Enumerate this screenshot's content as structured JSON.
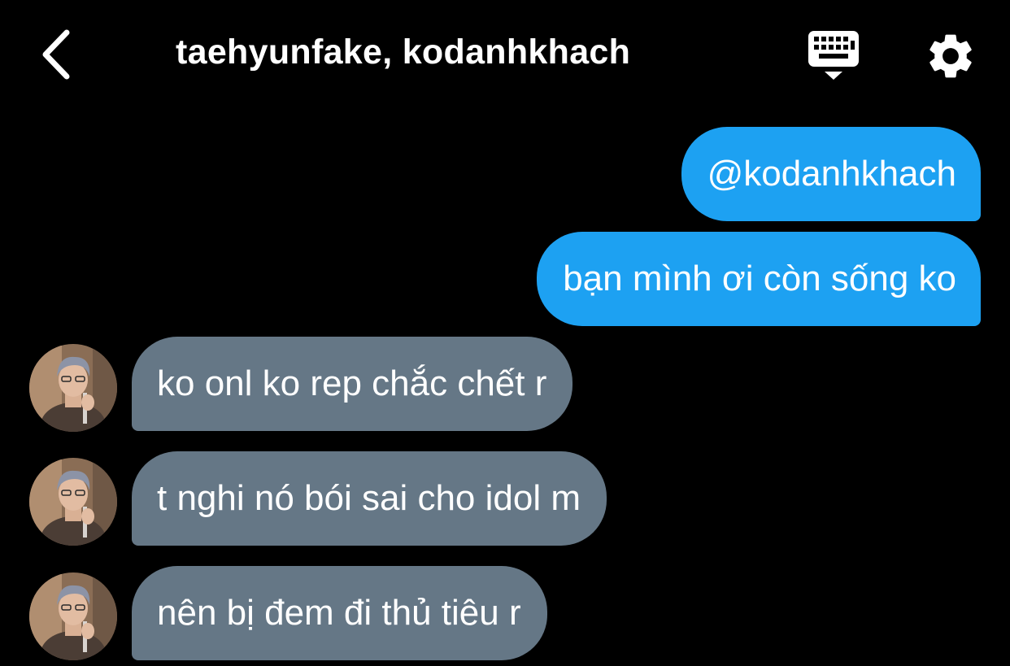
{
  "header": {
    "title": "taehyunfake, kodanhkhach",
    "back_icon": "chevron-left-icon",
    "keyboard_icon": "keyboard-icon",
    "settings_icon": "gear-icon"
  },
  "colors": {
    "background": "#000000",
    "outgoing_bubble": "#1da1f2",
    "incoming_bubble": "#657786",
    "text": "#ffffff"
  },
  "messages": [
    {
      "direction": "outgoing",
      "text": "@kodanhkhach"
    },
    {
      "direction": "outgoing",
      "text": "bạn mình ơi còn sống ko"
    },
    {
      "direction": "incoming",
      "text": "ko onl ko rep chắc chết r"
    },
    {
      "direction": "incoming",
      "text": "t nghi nó bói sai cho idol m"
    },
    {
      "direction": "incoming",
      "text": "nên bị đem đi thủ tiêu r"
    }
  ]
}
